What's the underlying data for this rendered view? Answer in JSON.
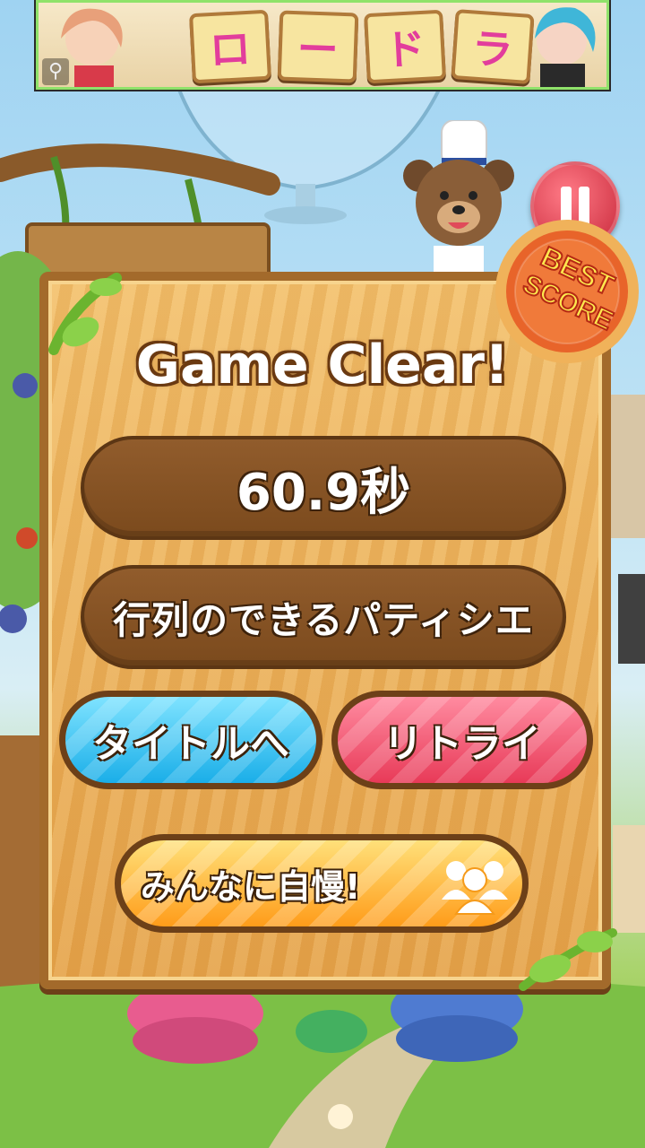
{
  "banner": {
    "title_chars": [
      "ロ",
      "ー",
      "ド",
      "ラ"
    ],
    "zoom_icon": "magnifier-icon"
  },
  "pause_icon": "pause-icon",
  "best_badge": {
    "line1": "BEST",
    "line2": "SCORE"
  },
  "result": {
    "heading": "Game Clear!",
    "time": "60.9秒",
    "rank_title": "行列のできるパティシエ"
  },
  "buttons": {
    "title": "タイトルへ",
    "retry": "リトライ",
    "share": "みんなに自慢!",
    "share_icon": "people-group-icon"
  },
  "colors": {
    "panel_wood": "#e6a54c",
    "title_button": "#1aaee8",
    "retry_button": "#e83a58",
    "share_button": "#ff9c1a",
    "badge": "#e8642a"
  }
}
